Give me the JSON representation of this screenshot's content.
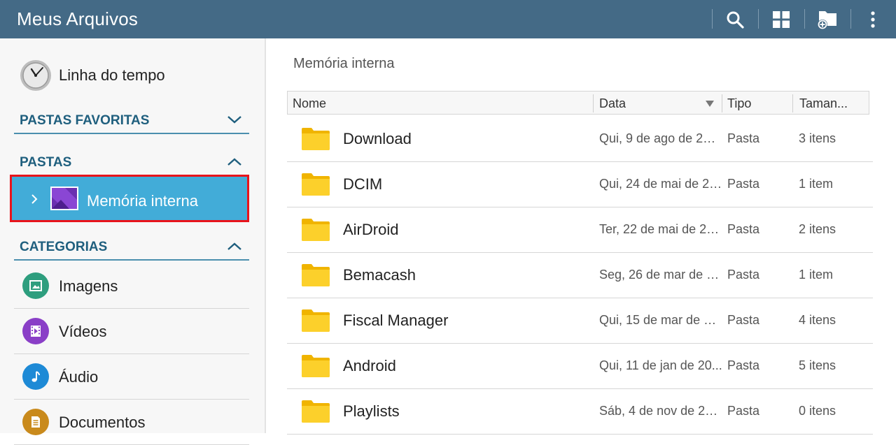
{
  "app": {
    "title": "Meus Arquivos"
  },
  "toolbar": {
    "icons": [
      "search-icon",
      "grid-view-icon",
      "new-folder-icon",
      "more-options-icon"
    ]
  },
  "sidebar": {
    "timeline_label": "Linha do tempo",
    "favorites_label": "PASTAS FAVORITAS",
    "folders_label": "PASTAS",
    "selected_folder_label": "Memória interna",
    "categories_label": "CATEGORIAS",
    "categories": [
      {
        "label": "Imagens",
        "icon": "image-icon",
        "color": "#2e9e7e"
      },
      {
        "label": "Vídeos",
        "icon": "video-icon",
        "color": "#8a3fc7"
      },
      {
        "label": "Áudio",
        "icon": "music-icon",
        "color": "#1e8ad6"
      },
      {
        "label": "Documentos",
        "icon": "document-icon",
        "color": "#c98a1c"
      }
    ]
  },
  "main": {
    "title": "Memória interna",
    "columns": {
      "name": "Nome",
      "date": "Data",
      "type": "Tipo",
      "size": "Taman..."
    },
    "rows": [
      {
        "name": "Download",
        "date": "Qui, 9 de ago de 201...",
        "type": "Pasta",
        "size": "3 itens"
      },
      {
        "name": "DCIM",
        "date": "Qui, 24 de mai de 20...",
        "type": "Pasta",
        "size": "1 item"
      },
      {
        "name": "AirDroid",
        "date": "Ter, 22 de mai de 20...",
        "type": "Pasta",
        "size": "2 itens"
      },
      {
        "name": "Bemacash",
        "date": "Seg, 26 de mar de 2...",
        "type": "Pasta",
        "size": "1 item"
      },
      {
        "name": "Fiscal Manager",
        "date": "Qui, 15 de mar de 20...",
        "type": "Pasta",
        "size": "4 itens"
      },
      {
        "name": "Android",
        "date": "Qui, 11 de jan de 20...",
        "type": "Pasta",
        "size": "5 itens"
      },
      {
        "name": "Playlists",
        "date": "Sáb, 4 de nov de 201...",
        "type": "Pasta",
        "size": "0 itens"
      }
    ]
  },
  "colors": {
    "topbar": "#446a86",
    "accent": "#1f5f7e",
    "selected": "#42acd8",
    "highlight_border": "#e8141b",
    "folder": "#f9c81e"
  }
}
